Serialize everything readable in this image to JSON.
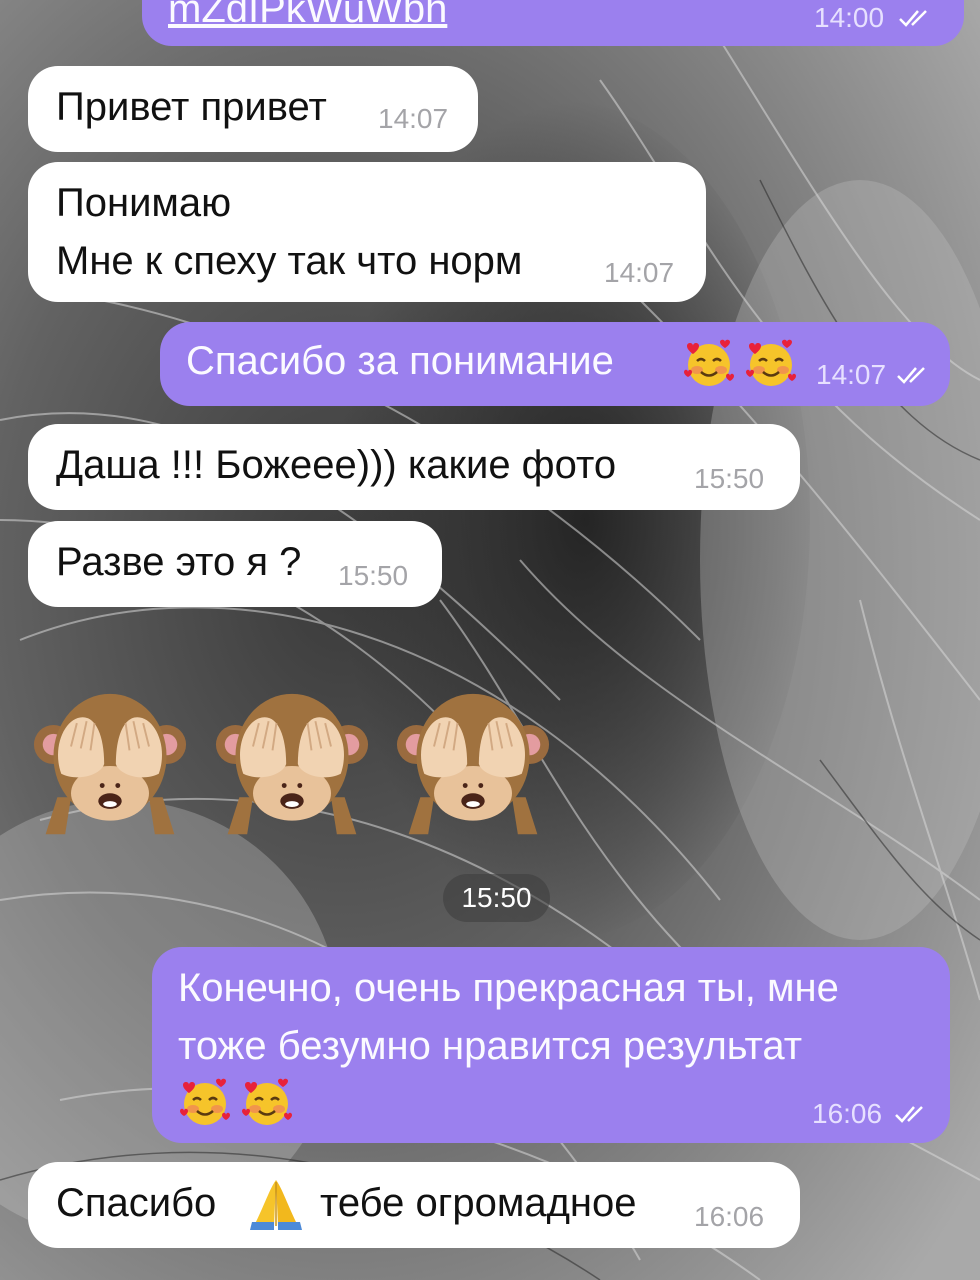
{
  "chat": {
    "top_message": {
      "link_text": "mZdIPkWuWbh",
      "time": "14:00"
    },
    "messages": [
      {
        "text": "Привет привет",
        "time": "14:07"
      },
      {
        "line1": "Понимаю",
        "line2": "Мне к спеху так что норм",
        "time": "14:07"
      },
      {
        "text": "Спасибо за понимание",
        "emojis": [
          "smiling-face-with-hearts-emoji",
          "smiling-face-with-hearts-emoji"
        ],
        "time": "14:07"
      },
      {
        "text": "Даша !!! Божеее))) какие фото",
        "time": "15:50"
      },
      {
        "text": "Разве это я ?",
        "time": "15:50"
      },
      {
        "emojis": [
          "see-no-evil-monkey-emoji",
          "see-no-evil-monkey-emoji",
          "see-no-evil-monkey-emoji"
        ],
        "time": "15:50"
      },
      {
        "line1": "Конечно, очень прекрасная ты, мне",
        "line2": "тоже безумно нравится результат",
        "emojis": [
          "smiling-face-with-hearts-emoji",
          "smiling-face-with-hearts-emoji"
        ],
        "time": "16:06"
      },
      {
        "text_before": "Спасибо",
        "emoji": "folded-hands-emoji",
        "text_after": "тебе огромадное",
        "time": "16:06"
      }
    ]
  },
  "colors": {
    "incoming_bubble": "#ffffff",
    "outgoing_bubble": "#9b80ee",
    "timestamp_pill": "#3c3c3c"
  },
  "icons": {
    "read_status": "double-check-icon"
  }
}
